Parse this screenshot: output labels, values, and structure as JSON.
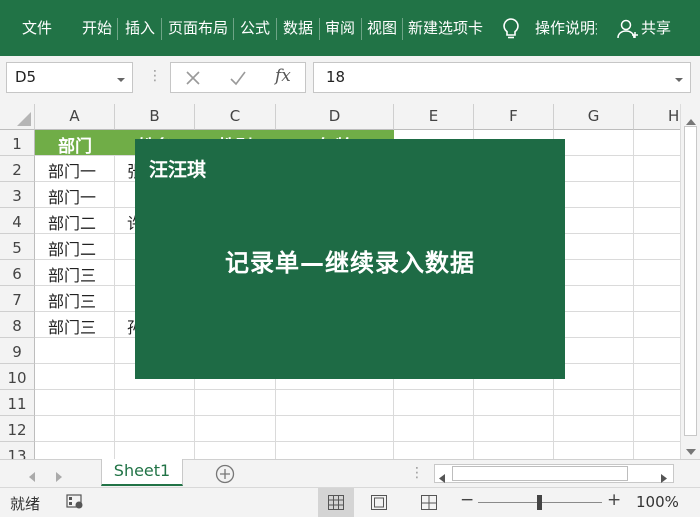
{
  "ribbon": {
    "tabs": [
      "文件",
      "开始",
      "插入",
      "页面布局",
      "公式",
      "数据",
      "审阅",
      "视图",
      "新建选项卡"
    ],
    "tell_me": "操作说明搜索",
    "share": "共享"
  },
  "formula_bar": {
    "name_box": "D5",
    "function_label": "fx",
    "value": "18"
  },
  "grid": {
    "columns": [
      "A",
      "B",
      "C",
      "D",
      "E",
      "F",
      "G",
      "H"
    ],
    "rows": [
      "1",
      "2",
      "3",
      "4",
      "5",
      "6",
      "7",
      "8",
      "9",
      "10",
      "11",
      "12",
      "13"
    ],
    "header_row": [
      "部门",
      "姓名",
      "性别",
      "年龄"
    ],
    "col_a": [
      "部门一",
      "部门一",
      "部门二",
      "部门二",
      "部门三",
      "部门三",
      "部门三"
    ],
    "col_b_fragments": {
      "row2": "张",
      "row4": "许",
      "row8": "孙"
    }
  },
  "sheet_tabs": {
    "active": "Sheet1"
  },
  "status_bar": {
    "ready": "就绪",
    "zoom": "100%"
  },
  "overlay": {
    "author": "汪汪琪",
    "title": "记录单—继续录入数据",
    "background": "#1e6b45"
  },
  "colors": {
    "ribbon": "#217346",
    "header_fill": "#70ad47",
    "sheet_tab_text": "#217346"
  }
}
